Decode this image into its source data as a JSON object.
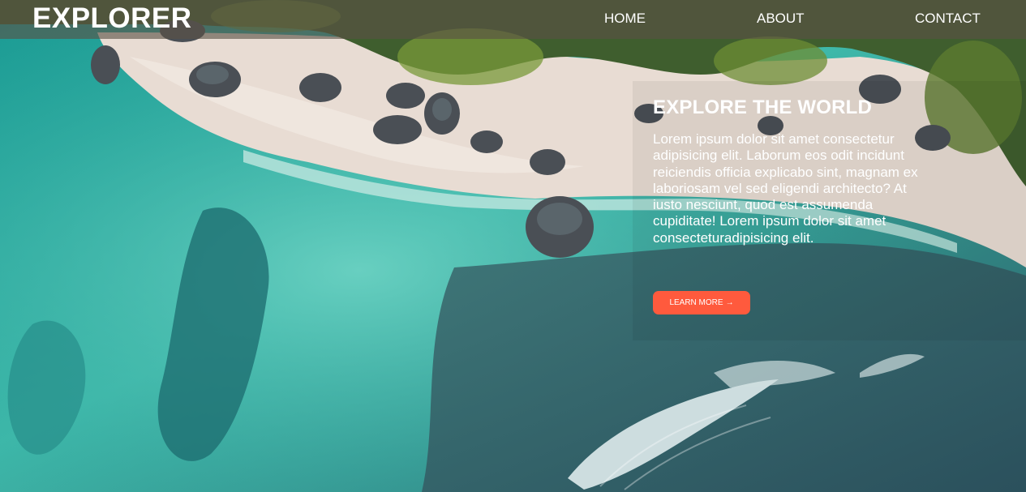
{
  "brand": "EXPLORER",
  "nav": {
    "home": "HOME",
    "about": "ABOUT",
    "contact": "CONTACT"
  },
  "hero": {
    "title": "EXPLORE THE WORLD",
    "text": "Lorem ipsum dolor sit amet consectetur adipisicing elit. Laborum eos odit incidunt reiciendis officia explicabo sint, magnam ex laboriosam vel sed eligendi architecto? At iusto nesciunt, quod est assumenda cupiditate! Lorem ipsum dolor sit amet consecteturadipisicing elit.",
    "cta_label": "LEARN MORE",
    "cta_icon": "arrow-right-icon",
    "cta_color": "#ff5a3d"
  },
  "colors": {
    "navbar": "#5a5046",
    "text": "#ffffff"
  }
}
